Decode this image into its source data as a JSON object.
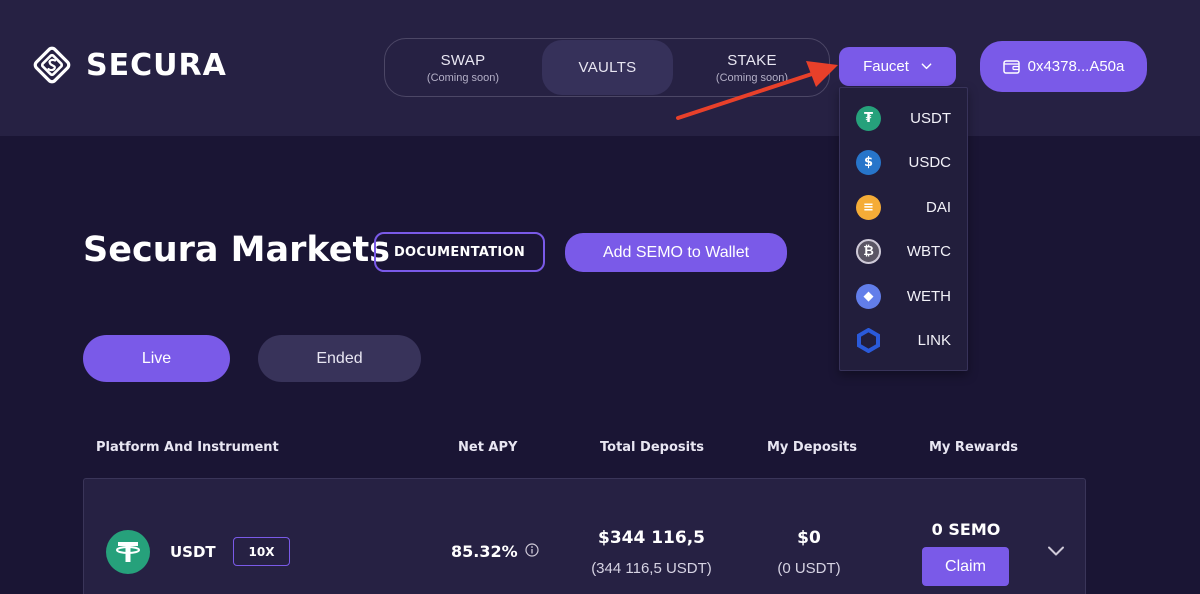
{
  "brand": {
    "name": "SECURA"
  },
  "nav": {
    "tabs": [
      {
        "label": "SWAP",
        "sub": "(Coming soon)"
      },
      {
        "label": "VAULTS",
        "sub": ""
      },
      {
        "label": "STAKE",
        "sub": "(Coming soon)"
      }
    ],
    "active": "VAULTS"
  },
  "faucet": {
    "label": "Faucet",
    "items": [
      {
        "token": "USDT",
        "icon": "usdt-icon",
        "color": "#26a17b"
      },
      {
        "token": "USDC",
        "icon": "usdc-icon",
        "color": "#2775ca"
      },
      {
        "token": "DAI",
        "icon": "dai-icon",
        "color": "#f5ac37"
      },
      {
        "token": "WBTC",
        "icon": "wbtc-icon",
        "color": "#5a5564"
      },
      {
        "token": "WETH",
        "icon": "weth-icon",
        "color": "#627eea"
      },
      {
        "token": "LINK",
        "icon": "link-icon",
        "color": "#2a5ada"
      }
    ]
  },
  "wallet": {
    "address": "0x4378...A50a"
  },
  "page": {
    "title": "Secura Markets",
    "doc_label": "DOCUMENTATION",
    "add_semo_label": "Add SEMO to Wallet"
  },
  "filters": {
    "live": "Live",
    "ended": "Ended"
  },
  "table": {
    "headers": [
      "Platform And Instrument",
      "Net APY",
      "Total Deposits",
      "My Deposits",
      "My Rewards"
    ],
    "rows": [
      {
        "token": "USDT",
        "leverage": "10X",
        "apy": "85.32%",
        "total_deposits": "$344 116,5",
        "total_deposits_sub": "(344 116,5 USDT)",
        "my_deposits": "$0",
        "my_deposits_sub": "(0 USDT)",
        "rewards": "0 SEMO",
        "claim_label": "Claim"
      }
    ]
  },
  "colors": {
    "accent": "#7a5ae8",
    "background": "#1a1534",
    "header": "#262143",
    "annotation_arrow": "#e8402a"
  }
}
